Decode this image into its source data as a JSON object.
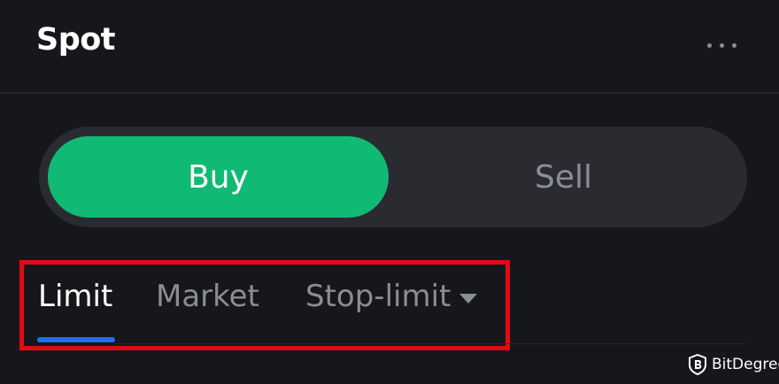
{
  "header": {
    "title": "Spot",
    "more_icon": "more-horizontal-icon"
  },
  "side_toggle": {
    "buy_label": "Buy",
    "sell_label": "Sell",
    "selected": "Buy",
    "buy_color": "#10ba75"
  },
  "order_tabs": {
    "items": [
      {
        "label": "Limit",
        "active": true
      },
      {
        "label": "Market",
        "active": false
      },
      {
        "label": "Stop-limit",
        "active": false,
        "has_dropdown": true
      }
    ],
    "active_underline_color": "#1e6ff0",
    "highlight_frame_color": "#e30b13"
  },
  "watermark": {
    "text": "BitDegree",
    "icon": "bitdegree-logo-icon"
  }
}
